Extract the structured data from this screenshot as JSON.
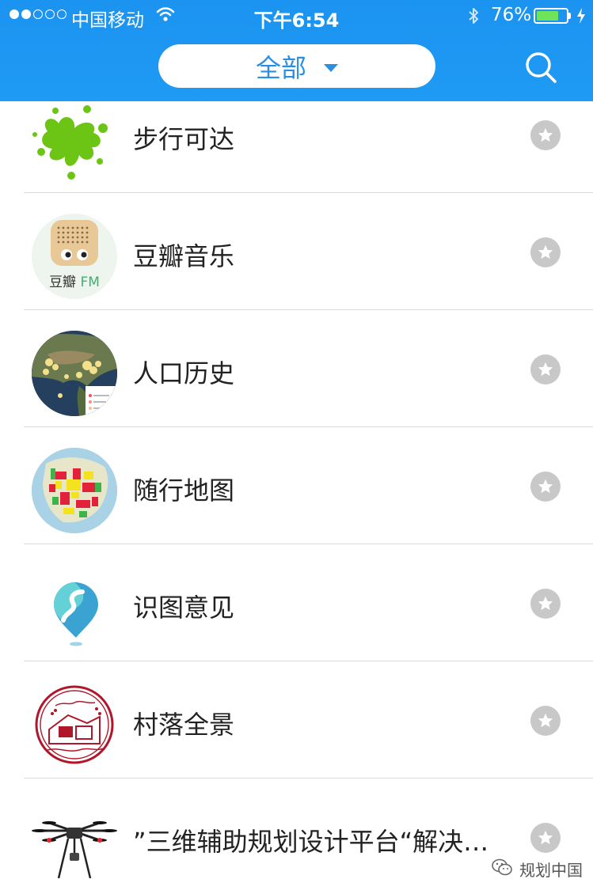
{
  "status_bar": {
    "carrier": "中国移动",
    "time": "下午6:54",
    "battery_percent": "76%",
    "battery_level": 0.76,
    "battery_color": "#6fe35a"
  },
  "header": {
    "filter_label": "全部",
    "accent_color": "#1b93f0",
    "search_icon": "search-icon"
  },
  "list": {
    "items": [
      {
        "title": "步行可达",
        "icon": "green-splash-icon",
        "favorite_icon": "star-icon"
      },
      {
        "title": "豆瓣音乐",
        "icon": "douban-fm-icon",
        "icon_label": "豆瓣",
        "icon_label_accent": "FM",
        "favorite_icon": "star-icon"
      },
      {
        "title": "人口历史",
        "icon": "satellite-map-icon",
        "favorite_icon": "star-icon"
      },
      {
        "title": "随行地图",
        "icon": "landuse-map-icon",
        "favorite_icon": "star-icon"
      },
      {
        "title": "识图意见",
        "icon": "map-pin-s-icon",
        "favorite_icon": "star-icon"
      },
      {
        "title": "村落全景",
        "icon": "village-seal-icon",
        "favorite_icon": "star-icon"
      },
      {
        "title": "”三维辅助规划设计平台“解决…",
        "icon": "drone-icon",
        "favorite_icon": "star-icon"
      }
    ]
  },
  "watermark": {
    "text": "规划中国",
    "icon": "wechat-icon"
  }
}
